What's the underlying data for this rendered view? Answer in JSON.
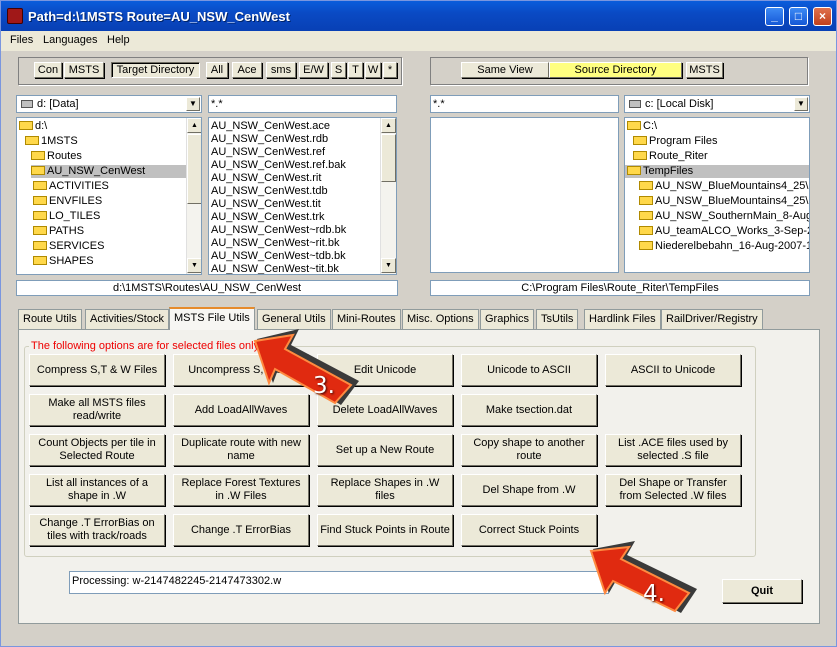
{
  "window": {
    "title": "Path=d:\\1MSTS  Route=AU_NSW_CenWest",
    "minimize": "_",
    "maximize": "□",
    "close": "×"
  },
  "menu": [
    "Files",
    "Languages",
    "Help"
  ],
  "left_toolbar": [
    "Con",
    "MSTS",
    "Target Directory",
    "All",
    "Ace",
    "sms",
    "E/W",
    "S",
    "T",
    "W",
    "*"
  ],
  "right_toolbar": [
    "Same View",
    "Source Directory",
    "MSTS"
  ],
  "left": {
    "drive": "d: [Data]",
    "filter": "*.*",
    "folders": [
      "d:\\",
      "1MSTS",
      "Routes",
      "AU_NSW_CenWest",
      "ACTIVITIES",
      "ENVFILES",
      "LO_TILES",
      "PATHS",
      "SERVICES",
      "SHAPES"
    ],
    "files": [
      "AU_NSW_CenWest.ace",
      "AU_NSW_CenWest.rdb",
      "AU_NSW_CenWest.ref",
      "AU_NSW_CenWest.ref.bak",
      "AU_NSW_CenWest.rit",
      "AU_NSW_CenWest.tdb",
      "AU_NSW_CenWest.tit",
      "AU_NSW_CenWest.trk",
      "AU_NSW_CenWest~rdb.bk",
      "AU_NSW_CenWest~rit.bk",
      "AU_NSW_CenWest~tdb.bk",
      "AU_NSW_CenWest~tit.bk"
    ],
    "path": "d:\\1MSTS\\Routes\\AU_NSW_CenWest"
  },
  "right": {
    "filter": "*.*",
    "drive": "c: [Local Disk]",
    "folders": [
      "C:\\",
      "Program Files",
      "Route_Riter",
      "TempFiles",
      "AU_NSW_BlueMountains4_25\\",
      "AU_NSW_BlueMountains4_25\\",
      "AU_NSW_SouthernMain_8-Aug",
      "AU_teamALCO_Works_3-Sep-2",
      "Niederelbebahn_16-Aug-2007-1"
    ],
    "path": "C:\\Program Files\\Route_Riter\\TempFiles"
  },
  "tabs": [
    "Route Utils",
    "Activities/Stock",
    "MSTS File Utils",
    "General Utils",
    "Mini-Routes",
    "Misc. Options",
    "Graphics",
    "TsUtils",
    "Hardlink Files",
    "RailDriver/Registry"
  ],
  "active_tab": "MSTS File Utils",
  "group_label": "The following options are for selected files only",
  "actions": [
    [
      "Compress S,T & W Files",
      "Uncompress S,T & W",
      "Edit Unicode",
      "Unicode to ASCII",
      "ASCII to Unicode"
    ],
    [
      "Make all MSTS files read/write",
      "Add LoadAllWaves",
      "Delete LoadAllWaves",
      "Make tsection.dat",
      ""
    ],
    [
      "Count Objects per tile in Selected Route",
      "Duplicate route with new name",
      "Set up a New Route",
      "Copy shape to another route",
      "List .ACE files used by selected .S file"
    ],
    [
      "List all instances of a shape in .W",
      "Replace Forest Textures in .W Files",
      "Replace Shapes in .W files",
      "Del Shape from .W",
      "Del Shape or Transfer from Selected .W files"
    ],
    [
      "Change .T ErrorBias on tiles with track/roads",
      "Change .T ErrorBias",
      "Find Stuck Points in Route",
      "Correct Stuck Points",
      ""
    ]
  ],
  "processing": "Processing: w-2147482245-2147473302.w",
  "quit": "Quit",
  "annotations": [
    "3.",
    "4."
  ],
  "colors": {
    "titlebar": "#0a4ac4",
    "source_dir": "#ffff80",
    "group_label": "#e00000",
    "arrow": "#e02010"
  }
}
